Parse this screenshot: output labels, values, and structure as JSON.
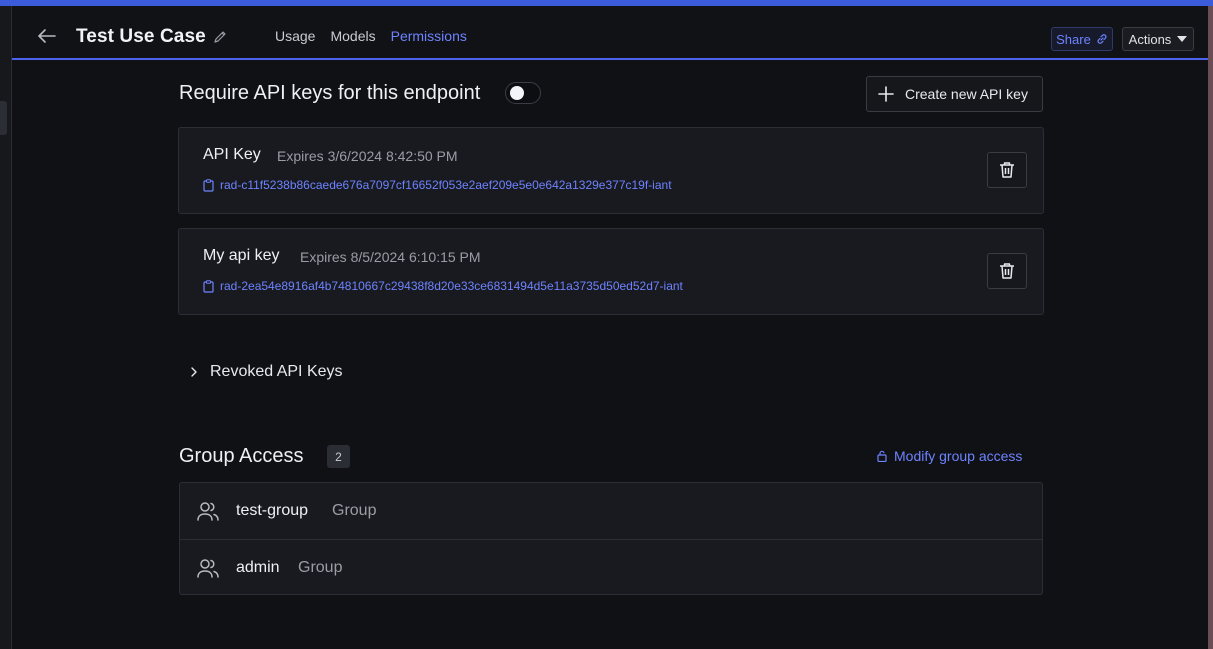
{
  "header": {
    "title": "Test Use Case",
    "tabs": [
      {
        "label": "Usage",
        "active": false
      },
      {
        "label": "Models",
        "active": false
      },
      {
        "label": "Permissions",
        "active": true
      }
    ],
    "share_label": "Share",
    "actions_label": "Actions"
  },
  "api": {
    "require_label": "Require API keys for this endpoint",
    "require_enabled": false,
    "create_label": "Create new API key",
    "keys": [
      {
        "name": "API Key",
        "expires": "Expires 3/6/2024 8:42:50 PM",
        "value": "rad-c11f5238b86caede676a7097cf16652f053e2aef209e5e0e642a1329e377c19f-iant"
      },
      {
        "name": "My api key",
        "expires": "Expires 8/5/2024 6:10:15 PM",
        "value": "rad-2ea54e8916af4b74810667c29438f8d20e33ce6831494d5e11a3735d50ed52d7-iant"
      }
    ],
    "revoked_label": "Revoked API Keys"
  },
  "groups": {
    "title": "Group Access",
    "count": "2",
    "modify_label": "Modify group access",
    "items": [
      {
        "name": "test-group",
        "type": "Group"
      },
      {
        "name": "admin",
        "type": "Group"
      }
    ]
  },
  "colors": {
    "accent": "#6d83ff",
    "background": "#101114",
    "card": "#191a20"
  }
}
